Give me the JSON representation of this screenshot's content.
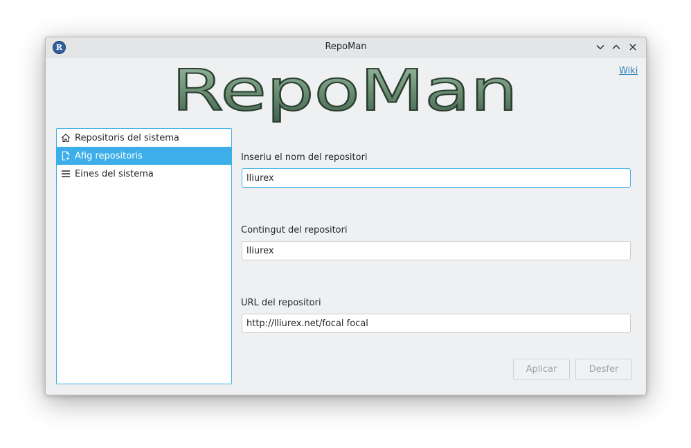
{
  "window": {
    "title": "RepoMan",
    "app_icon_letter": "R",
    "controls": [
      "minimize",
      "maximize",
      "close"
    ]
  },
  "header": {
    "logo_text": "RepoMan",
    "wiki_link": "Wiki"
  },
  "sidebar": {
    "items": [
      {
        "label": "Repositoris del sistema",
        "icon": "home-icon",
        "selected": false
      },
      {
        "label": "Afig repositoris",
        "icon": "add-document-icon",
        "selected": true
      },
      {
        "label": "Eines del sistema",
        "icon": "menu-icon",
        "selected": false
      }
    ]
  },
  "form": {
    "name_label": "Inseriu el nom del repositori",
    "name_value": "lliurex",
    "content_label": "Contingut del repositori",
    "content_value": "lliurex",
    "url_label": "URL del repositori",
    "url_value": "http://lliurex.net/focal focal"
  },
  "buttons": {
    "apply": "Aplicar",
    "undo": "Desfer",
    "enabled": false
  },
  "colors": {
    "accent": "#3daee9",
    "logo_fill": "#6b8f75",
    "window_bg": "#eff0f1"
  }
}
